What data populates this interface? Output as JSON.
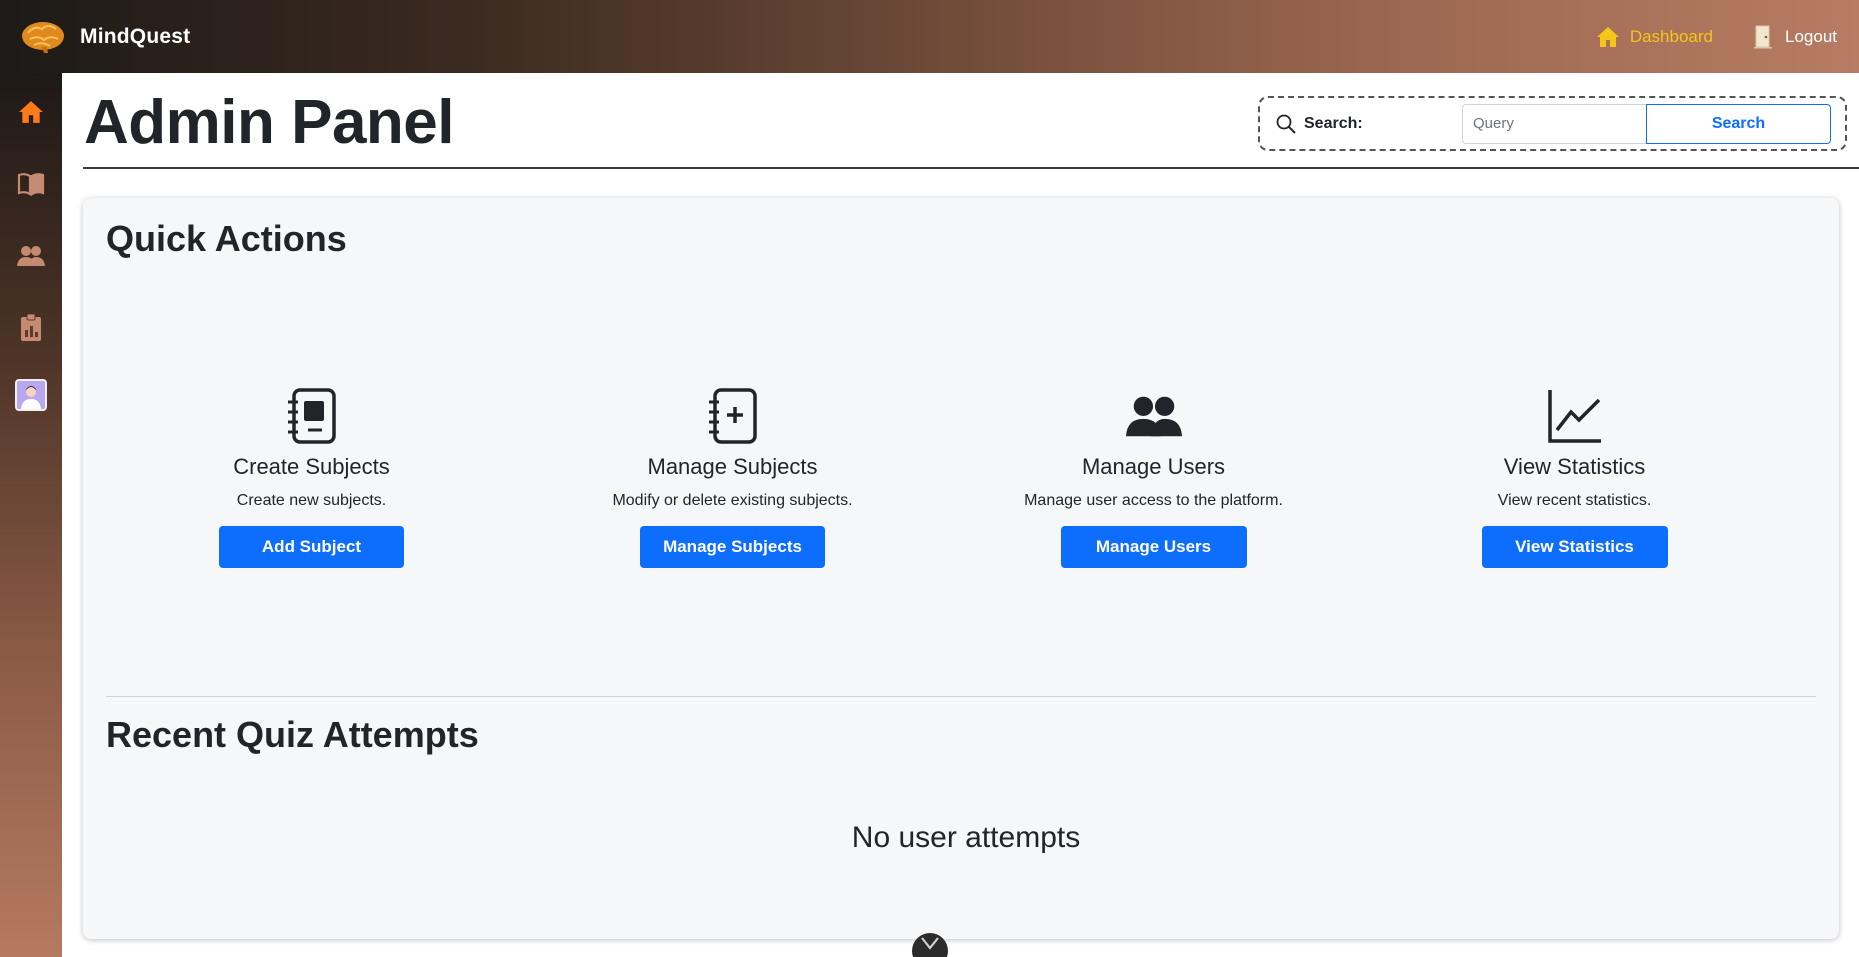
{
  "header": {
    "brand": "MindQuest",
    "nav": {
      "dashboard": "Dashboard",
      "logout": "Logout"
    },
    "colors": {
      "dashboard_accent": "#f5c518",
      "logo": "#e08a1e"
    }
  },
  "sidebar": {
    "items": [
      {
        "icon": "home-icon",
        "color": "#ff7a1a"
      },
      {
        "icon": "book-icon",
        "color": "#c58b72"
      },
      {
        "icon": "users-icon",
        "color": "#c58b72"
      },
      {
        "icon": "clipboard-chart-icon",
        "color": "#c58b72"
      },
      {
        "icon": "avatar"
      }
    ]
  },
  "page": {
    "title": "Admin Panel"
  },
  "search": {
    "label": "Search:",
    "placeholder": "Query",
    "button": "Search"
  },
  "quick_actions": {
    "title": "Quick Actions",
    "items": [
      {
        "icon": "notebook-icon",
        "title": "Create Subjects",
        "description": "Create new subjects.",
        "button": "Add Subject"
      },
      {
        "icon": "notebook-plus-icon",
        "title": "Manage Subjects",
        "description": "Modify or delete existing subjects.",
        "button": "Manage Subjects"
      },
      {
        "icon": "people-icon",
        "title": "Manage Users",
        "description": "Manage user access to the platform.",
        "button": "Manage Users"
      },
      {
        "icon": "line-chart-icon",
        "title": "View Statistics",
        "description": "View recent statistics.",
        "button": "View Statistics"
      }
    ],
    "button_color": "#0d6efd"
  },
  "recent_attempts": {
    "title": "Recent Quiz Attempts",
    "empty_message": "No user attempts"
  }
}
